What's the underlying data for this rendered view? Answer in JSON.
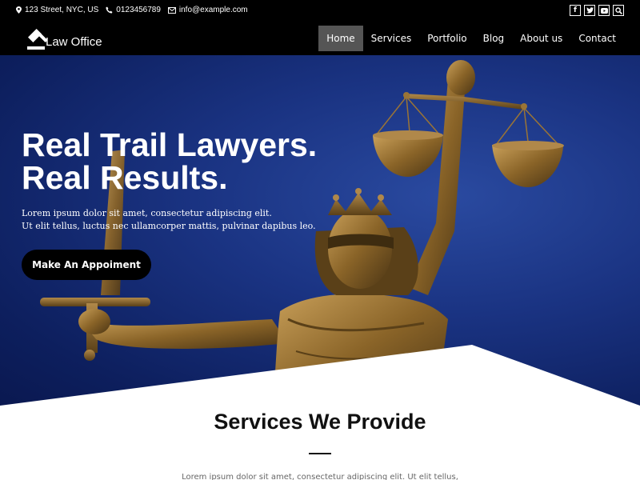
{
  "topbar": {
    "address": "123 Street, NYC, US",
    "phone": "0123456789",
    "email": "info@example.com",
    "socials": [
      "facebook-icon",
      "twitter-icon",
      "youtube-icon",
      "search-icon"
    ]
  },
  "header": {
    "logo_text": "Law Office",
    "nav": [
      {
        "label": "Home",
        "active": true
      },
      {
        "label": "Services",
        "active": false
      },
      {
        "label": "Portfolio",
        "active": false
      },
      {
        "label": "Blog",
        "active": false
      },
      {
        "label": "About us",
        "active": false
      },
      {
        "label": "Contact",
        "active": false
      }
    ]
  },
  "hero": {
    "title_line1": "Real Trail Lawyers.",
    "title_line2": "Real Results.",
    "subtitle_line1": "Lorem ipsum dolor sit amet, consectetur adipiscing elit.",
    "subtitle_line2": "Ut elit tellus, luctus nec ullamcorper mattis, pulvinar dapibus leo.",
    "cta_label": "Make An Appoiment"
  },
  "services": {
    "title": "Services We Provide",
    "text": "Lorem ipsum dolor sit amet, consectetur adipiscing elit. Ut elit tellus,"
  },
  "colors": {
    "bar": "#000000",
    "active_nav": "#555555",
    "hero_blue": "#1a3382",
    "bronze": "#a07a3a"
  }
}
